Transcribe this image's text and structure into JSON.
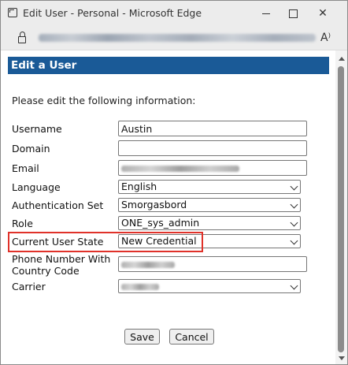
{
  "window": {
    "title": "Edit User - Personal - Microsoft Edge",
    "minimize_icon": "minimize-icon",
    "maximize_icon": "maximize-icon",
    "close_glyph": "✕"
  },
  "address_bar": {
    "read_aloud_glyph": "A⁾",
    "icons": [
      "lock-icon",
      "read-aloud-icon"
    ]
  },
  "form": {
    "header": "Edit a User",
    "instructions": "Please edit the following information:",
    "fields": {
      "username": {
        "label": "Username",
        "value": "Austin"
      },
      "domain": {
        "label": "Domain",
        "value": ""
      },
      "email": {
        "label": "Email"
      },
      "language": {
        "label": "Language",
        "value": "English"
      },
      "auth_set": {
        "label": "Authentication Set",
        "value": "Smorgasbord"
      },
      "role": {
        "label": "Role",
        "value": "ONE_sys_admin"
      },
      "user_state": {
        "label": "Current User State",
        "value": "New Credential"
      },
      "phone": {
        "label_line1": "Phone Number With",
        "label_line2": "Country Code"
      },
      "carrier": {
        "label": "Carrier"
      }
    },
    "buttons": {
      "save": "Save",
      "cancel": "Cancel"
    }
  },
  "colors": {
    "header_bg": "#1a5a97",
    "highlight": "#e0322a"
  }
}
